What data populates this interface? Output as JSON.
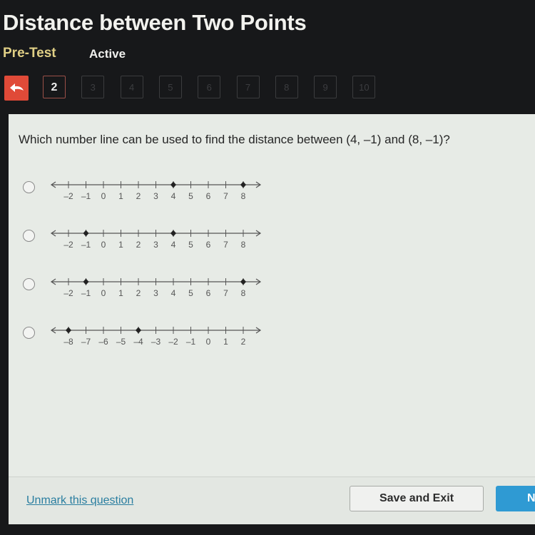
{
  "header": {
    "title": "Distance between Two Points",
    "mode": "Pre-Test",
    "status": "Active"
  },
  "nav": {
    "back_icon": "back-arrow-icon",
    "questions": [
      {
        "label": "2",
        "state": "current"
      },
      {
        "label": "3",
        "state": "disabled"
      },
      {
        "label": "4",
        "state": "disabled"
      },
      {
        "label": "5",
        "state": "disabled"
      },
      {
        "label": "6",
        "state": "disabled"
      },
      {
        "label": "7",
        "state": "disabled"
      },
      {
        "label": "8",
        "state": "disabled"
      },
      {
        "label": "9",
        "state": "disabled"
      },
      {
        "label": "10",
        "state": "disabled"
      }
    ]
  },
  "question": {
    "text": "Which number line can be used to find the distance between (4, –1) and (8, –1)?",
    "options": [
      {
        "min": -2,
        "max": 8,
        "points": [
          4,
          8
        ],
        "selected": false
      },
      {
        "min": -2,
        "max": 8,
        "points": [
          -1,
          4
        ],
        "selected": false
      },
      {
        "min": -2,
        "max": 8,
        "points": [
          -1,
          8
        ],
        "selected": false
      },
      {
        "min": -8,
        "max": 2,
        "points": [
          -8,
          -4
        ],
        "selected": false
      }
    ]
  },
  "footer": {
    "unmark_label": "Unmark this question",
    "save_label": "Save and Exit",
    "next_label": "N"
  },
  "colors": {
    "back_button": "#e04a38",
    "mode_text": "#e0cf85",
    "link": "#2a7ea0",
    "next_button": "#2f9ad3"
  }
}
